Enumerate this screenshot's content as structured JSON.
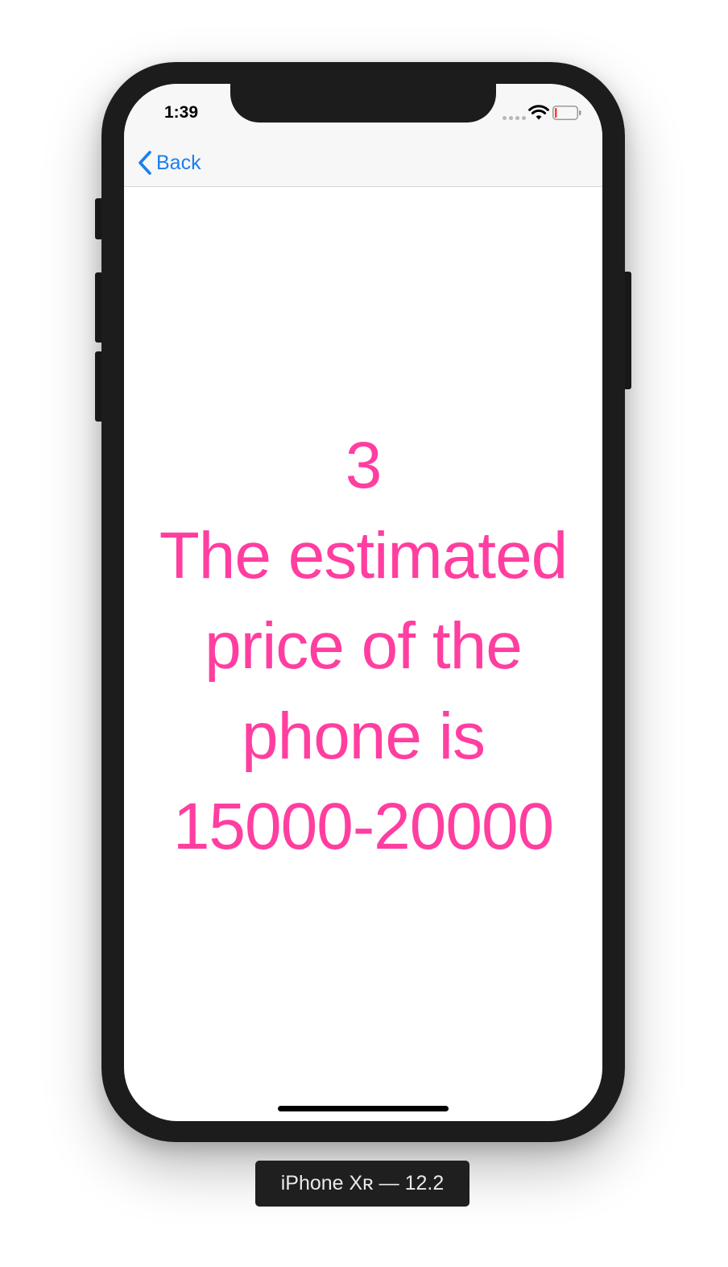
{
  "status_bar": {
    "time": "1:39"
  },
  "nav": {
    "back_label": "Back",
    "accent_color": "#1b7ef0"
  },
  "content": {
    "number": "3",
    "lines": [
      "The estimated",
      "price of the",
      "phone is",
      "15000-20000"
    ],
    "text_color": "#ff3ea0"
  },
  "device": {
    "label": "iPhone Xʀ — 12.2"
  },
  "icons": {
    "back": "chevron-left-icon",
    "wifi": "wifi-icon",
    "battery": "battery-icon",
    "signal": "cellular-signal-icon"
  }
}
